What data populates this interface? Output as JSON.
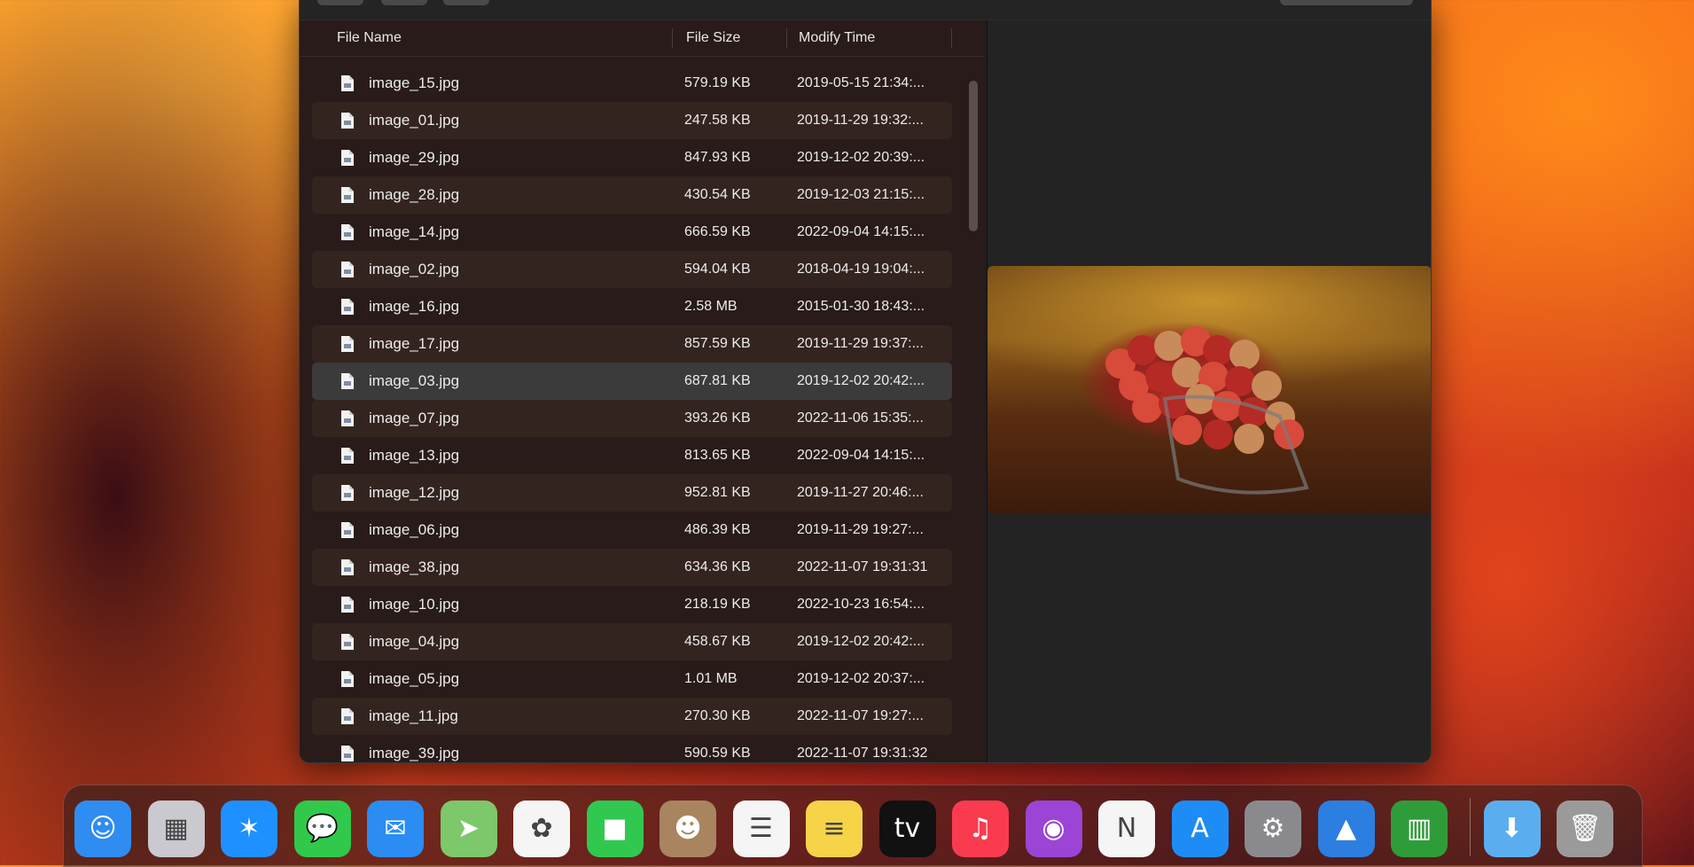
{
  "table": {
    "headers": {
      "name": "File Name",
      "size": "File Size",
      "time": "Modify Time"
    },
    "rows": [
      {
        "name": "image_15.jpg",
        "size": "579.19 KB",
        "time": "2019-05-15 21:34:..."
      },
      {
        "name": "image_01.jpg",
        "size": "247.58 KB",
        "time": "2019-11-29 19:32:..."
      },
      {
        "name": "image_29.jpg",
        "size": "847.93 KB",
        "time": "2019-12-02 20:39:..."
      },
      {
        "name": "image_28.jpg",
        "size": "430.54 KB",
        "time": "2019-12-03 21:15:..."
      },
      {
        "name": "image_14.jpg",
        "size": "666.59 KB",
        "time": "2022-09-04 14:15:..."
      },
      {
        "name": "image_02.jpg",
        "size": "594.04 KB",
        "time": "2018-04-19 19:04:..."
      },
      {
        "name": "image_16.jpg",
        "size": "2.58 MB",
        "time": "2015-01-30 18:43:..."
      },
      {
        "name": "image_17.jpg",
        "size": "857.59 KB",
        "time": "2019-11-29 19:37:..."
      },
      {
        "name": "image_03.jpg",
        "size": "687.81 KB",
        "time": "2019-12-02 20:42:..."
      },
      {
        "name": "image_07.jpg",
        "size": "393.26 KB",
        "time": "2022-11-06 15:35:..."
      },
      {
        "name": "image_13.jpg",
        "size": "813.65 KB",
        "time": "2022-09-04 14:15:..."
      },
      {
        "name": "image_12.jpg",
        "size": "952.81 KB",
        "time": "2019-11-27 20:46:..."
      },
      {
        "name": "image_06.jpg",
        "size": "486.39 KB",
        "time": "2019-11-29 19:27:..."
      },
      {
        "name": "image_38.jpg",
        "size": "634.36 KB",
        "time": "2022-11-07 19:31:31"
      },
      {
        "name": "image_10.jpg",
        "size": "218.19 KB",
        "time": "2022-10-23 16:54:..."
      },
      {
        "name": "image_04.jpg",
        "size": "458.67 KB",
        "time": "2019-12-02 20:42:..."
      },
      {
        "name": "image_05.jpg",
        "size": "1.01 MB",
        "time": "2019-12-02 20:37:..."
      },
      {
        "name": "image_11.jpg",
        "size": "270.30 KB",
        "time": "2022-11-07 19:27:..."
      },
      {
        "name": "image_39.jpg",
        "size": "590.59 KB",
        "time": "2022-11-07 19:31:32"
      }
    ],
    "selected_row": "image_03.jpg"
  },
  "preview": {
    "image": "red-apples-in-basket-photo"
  },
  "dock": {
    "apps": [
      {
        "name": "finder",
        "icon": "finder-icon",
        "color": "#2f8cf0",
        "glyph": "☺"
      },
      {
        "name": "launchpad",
        "icon": "launchpad-icon",
        "color": "#c9c9cf",
        "glyph": "▦"
      },
      {
        "name": "safari",
        "icon": "safari-icon",
        "color": "#1e90ff",
        "glyph": "✶"
      },
      {
        "name": "messages",
        "icon": "messages-icon",
        "color": "#30c94b",
        "glyph": "💬"
      },
      {
        "name": "mail",
        "icon": "mail-icon",
        "color": "#2b8cf3",
        "glyph": "✉"
      },
      {
        "name": "maps",
        "icon": "maps-icon",
        "color": "#7cc86a",
        "glyph": "➤"
      },
      {
        "name": "photos",
        "icon": "photos-icon",
        "color": "#f5f5f5",
        "glyph": "✿"
      },
      {
        "name": "facetime",
        "icon": "facetime-icon",
        "color": "#31c84f",
        "glyph": "■"
      },
      {
        "name": "contacts",
        "icon": "contacts-icon",
        "color": "#a8845f",
        "glyph": "☻"
      },
      {
        "name": "reminders",
        "icon": "reminders-icon",
        "color": "#f5f5f5",
        "glyph": "☰"
      },
      {
        "name": "notes",
        "icon": "notes-icon",
        "color": "#f7d348",
        "glyph": "≡"
      },
      {
        "name": "apple-tv",
        "icon": "apple-tv-icon",
        "color": "#111111",
        "glyph": "tv"
      },
      {
        "name": "music",
        "icon": "music-icon",
        "color": "#fa3b4f",
        "glyph": "♫"
      },
      {
        "name": "podcasts",
        "icon": "podcasts-icon",
        "color": "#9b44d6",
        "glyph": "◉"
      },
      {
        "name": "news",
        "icon": "news-icon",
        "color": "#f5f5f5",
        "glyph": "N"
      },
      {
        "name": "app-store",
        "icon": "app-store-icon",
        "color": "#1d8df5",
        "glyph": "A"
      },
      {
        "name": "system-settings",
        "icon": "system-settings-icon",
        "color": "#8a8a8e",
        "glyph": "⚙"
      },
      {
        "name": "apple-configurator",
        "icon": "mountain-icon",
        "color": "#2c7fe0",
        "glyph": "▲"
      },
      {
        "name": "archive-utility",
        "icon": "archive-books-icon",
        "color": "#2f9c3a",
        "glyph": "▥"
      }
    ],
    "others": [
      {
        "name": "downloads",
        "icon": "downloads-folder-icon",
        "color": "#5aaef0",
        "glyph": "⬇"
      },
      {
        "name": "trash",
        "icon": "trash-icon",
        "color": "#9a9a9a",
        "glyph": "🗑"
      }
    ]
  }
}
